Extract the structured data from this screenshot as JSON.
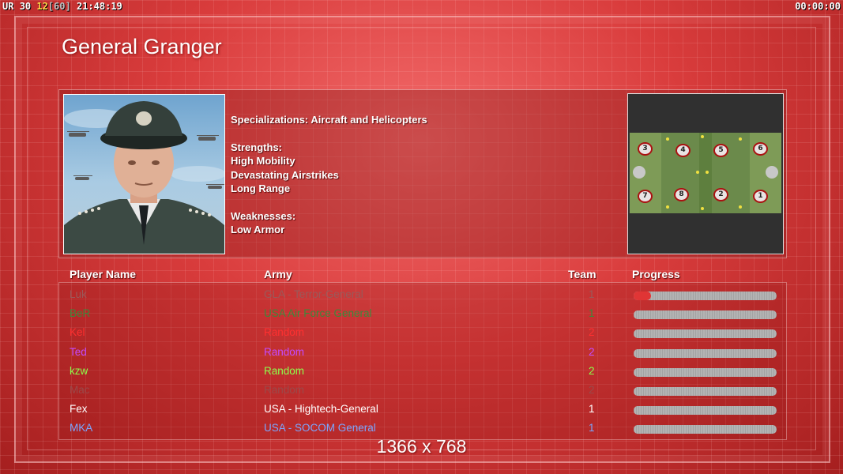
{
  "hud": {
    "left_a": "UR",
    "left_b": "30",
    "left_c": "12",
    "left_d": "[60]",
    "clock": "21:48:19",
    "timer": "00:00:00"
  },
  "general": {
    "name": "General Granger",
    "specializations": "Specializations: Aircraft and Helicopters",
    "strengths_label": "Strengths:",
    "strengths": [
      "High Mobility",
      "Devastating Airstrikes",
      "Long Range"
    ],
    "weaknesses_label": "Weaknesses:",
    "weaknesses": [
      "Low Armor"
    ]
  },
  "minimap": {
    "slots_top": [
      "3",
      "4",
      "5",
      "6"
    ],
    "slots_bottom": [
      "7",
      "8",
      "2",
      "1"
    ]
  },
  "table": {
    "headers": {
      "name": "Player Name",
      "army": "Army",
      "team": "Team",
      "progress": "Progress"
    },
    "rows": [
      {
        "name": "Luk",
        "army": "GLA - Terror-General",
        "team": "1",
        "color": "#9a5a5a",
        "progress": 0.12
      },
      {
        "name": "BeR",
        "army": "USA Air Force General",
        "team": "1",
        "color": "#3a8a3a",
        "progress": 0.0
      },
      {
        "name": "Kel",
        "army": "Random",
        "team": "2",
        "color": "#ff3030",
        "progress": 0.0
      },
      {
        "name": "Ted",
        "army": "Random",
        "team": "2",
        "color": "#c34bff",
        "progress": 0.0
      },
      {
        "name": "kzw",
        "army": "Random",
        "team": "2",
        "color": "#8cff4a",
        "progress": 0.0
      },
      {
        "name": "Mac",
        "army": "Random",
        "team": "2",
        "color": "#9a4a4a",
        "progress": 0.0
      },
      {
        "name": "Fex",
        "army": "USA - Hightech-General",
        "team": "1",
        "color": "#ffffff",
        "progress": 0.0
      },
      {
        "name": "MKA",
        "army": "USA - SOCOM General",
        "team": "1",
        "color": "#7aa6ff",
        "progress": 0.0
      }
    ]
  },
  "resolution": "1366 x 768"
}
